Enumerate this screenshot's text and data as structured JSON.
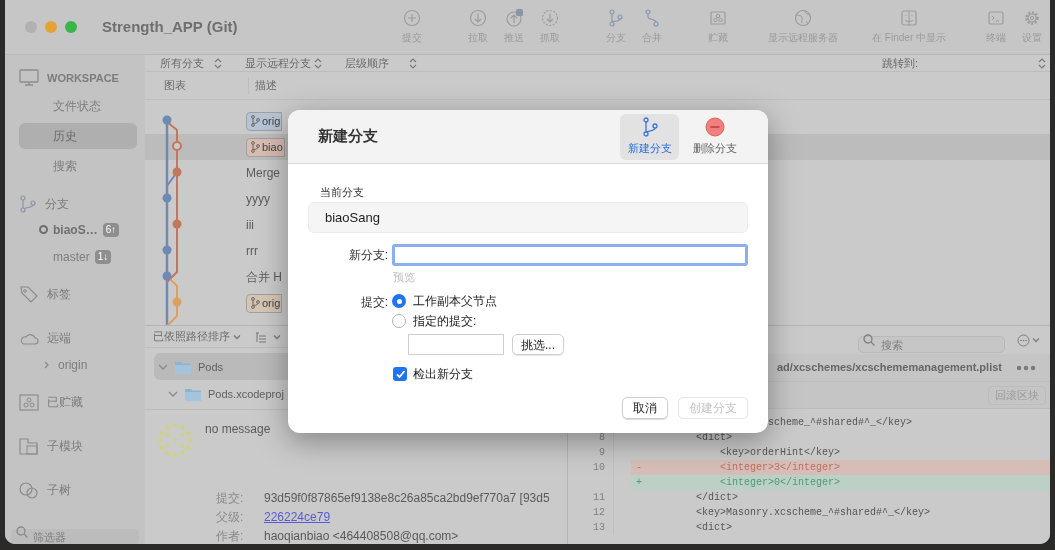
{
  "window": {
    "title": "Strength_APP (Git)"
  },
  "toolbar": [
    {
      "items": [
        {
          "label": "提交",
          "kind": "commit"
        }
      ]
    },
    {
      "items": [
        {
          "label": "拉取",
          "kind": "pull"
        },
        {
          "label": "推送",
          "kind": "push"
        },
        {
          "label": "抓取",
          "kind": "fetch"
        }
      ]
    },
    {
      "items": [
        {
          "label": "分支",
          "kind": "branch"
        },
        {
          "label": "合并",
          "kind": "merge"
        }
      ]
    },
    {
      "items": [
        {
          "label": "贮藏",
          "kind": "stash"
        }
      ]
    },
    {
      "items": [
        {
          "label": "显示远程服务器",
          "kind": "globe"
        }
      ]
    },
    {
      "items": [
        {
          "label": "在 Finder 中显示",
          "kind": "finder"
        }
      ]
    },
    {
      "items": [
        {
          "label": "终端",
          "kind": "terminal"
        },
        {
          "label": "设置",
          "kind": "settings"
        }
      ]
    }
  ],
  "sidebar": {
    "sections": [
      {
        "title": "WORKSPACE",
        "kind": "workspace",
        "items": [
          {
            "label": "文件状态",
            "selected": false
          },
          {
            "label": "历史",
            "selected": true
          },
          {
            "label": "搜索",
            "selected": false
          }
        ]
      },
      {
        "title": "分支",
        "kind": "branches",
        "branches": [
          {
            "label": "biaoS…",
            "badge": "6↑",
            "current": true
          },
          {
            "label": "master",
            "badge": "1↓",
            "current": false
          }
        ]
      },
      {
        "title": "标签",
        "kind": "tags"
      },
      {
        "title": "远端",
        "kind": "remotes",
        "remotes": [
          {
            "label": "origin",
            "expanded": false
          }
        ]
      },
      {
        "title": "已贮藏",
        "kind": "stashes"
      },
      {
        "title": "子模块",
        "kind": "submodules"
      },
      {
        "title": "子树",
        "kind": "subtrees"
      }
    ],
    "filter": {
      "placeholder": "筛选器"
    }
  },
  "history": {
    "filters": [
      "所有分支",
      "显示远程分支",
      "层级顺序"
    ],
    "jump_label": "跳转到:",
    "columns": [
      "图表",
      "描述"
    ],
    "rows": [
      {
        "kind": "branch",
        "text": "orig",
        "color": "#b7c3d6",
        "selected": false
      },
      {
        "kind": "branch",
        "text": "biao",
        "color": "#d9bcb2",
        "selected": true
      },
      {
        "kind": "message",
        "text": "Merge",
        "selected": false
      },
      {
        "kind": "message",
        "text": "yyyy",
        "selected": false
      },
      {
        "kind": "message",
        "text": "iii",
        "selected": false
      },
      {
        "kind": "message",
        "text": "rrr",
        "selected": false
      },
      {
        "kind": "message",
        "text": "合并 H",
        "selected": false
      },
      {
        "kind": "branch",
        "text": "orig",
        "color": "#d6c5b3",
        "selected": false
      }
    ]
  },
  "changes": {
    "sort_label": "已依照路径排序",
    "tree": [
      {
        "name": "Pods",
        "selected": true,
        "expanded": true,
        "children": [
          {
            "name": "Pods.xcodeproj",
            "selected": false,
            "expanded": true
          }
        ]
      }
    ]
  },
  "commit": {
    "message": "no message",
    "fields": [
      {
        "label": "提交:",
        "value": "93d59f0f87865ef9138e8c26a85ca2bd9ef770a7 [93d5",
        "kind": "text"
      },
      {
        "label": "父级:",
        "value": "226224ce79",
        "kind": "link"
      },
      {
        "label": "作者:",
        "value": "haoqianbiao <464408508@qq.com>",
        "kind": "text"
      }
    ]
  },
  "diff": {
    "search_placeholder": "搜索",
    "file_path": "ad/xcschemes/xcschememanagement.plist",
    "hunk_button": "回滚区块",
    "lines": [
      {
        "kind": "context",
        "text": "                    scheme_^#shared#^_</key>"
      },
      {
        "number": "8",
        "kind": "context",
        "text": "        <dict>"
      },
      {
        "number": "9",
        "kind": "context",
        "text": "            <key>orderHint</key>"
      },
      {
        "number": "10",
        "kind": "removed",
        "marker": "-",
        "text": "            <integer>3</integer>"
      },
      {
        "kind": "added",
        "marker": "+",
        "text": "            <integer>0</integer>"
      },
      {
        "number": "11",
        "kind": "context",
        "text": "        </dict>"
      },
      {
        "number": "12",
        "kind": "context",
        "text": "        <key>Masonry.xcscheme_^#shared#^_</key>"
      },
      {
        "number": "13",
        "kind": "context",
        "text": "        <dict>"
      }
    ]
  },
  "dialog": {
    "title": "新建分支",
    "tabs": [
      {
        "label": "新建分支",
        "kind": "new",
        "selected": true
      },
      {
        "label": "删除分支",
        "kind": "delete",
        "selected": false
      }
    ],
    "current_branch_label": "当前分支",
    "current_branch": "biaoSang",
    "new_branch_label": "新分支:",
    "preview": "预览",
    "commit_label": "提交:",
    "commit_options": [
      {
        "label": "工作副本父节点",
        "selected": true
      },
      {
        "label": "指定的提交:",
        "selected": false
      }
    ],
    "pick_button": "挑选...",
    "checkout": {
      "label": "检出新分支",
      "checked": true
    },
    "buttons": [
      {
        "label": "取消",
        "disabled": false
      },
      {
        "label": "创建分支",
        "disabled": true
      }
    ]
  }
}
